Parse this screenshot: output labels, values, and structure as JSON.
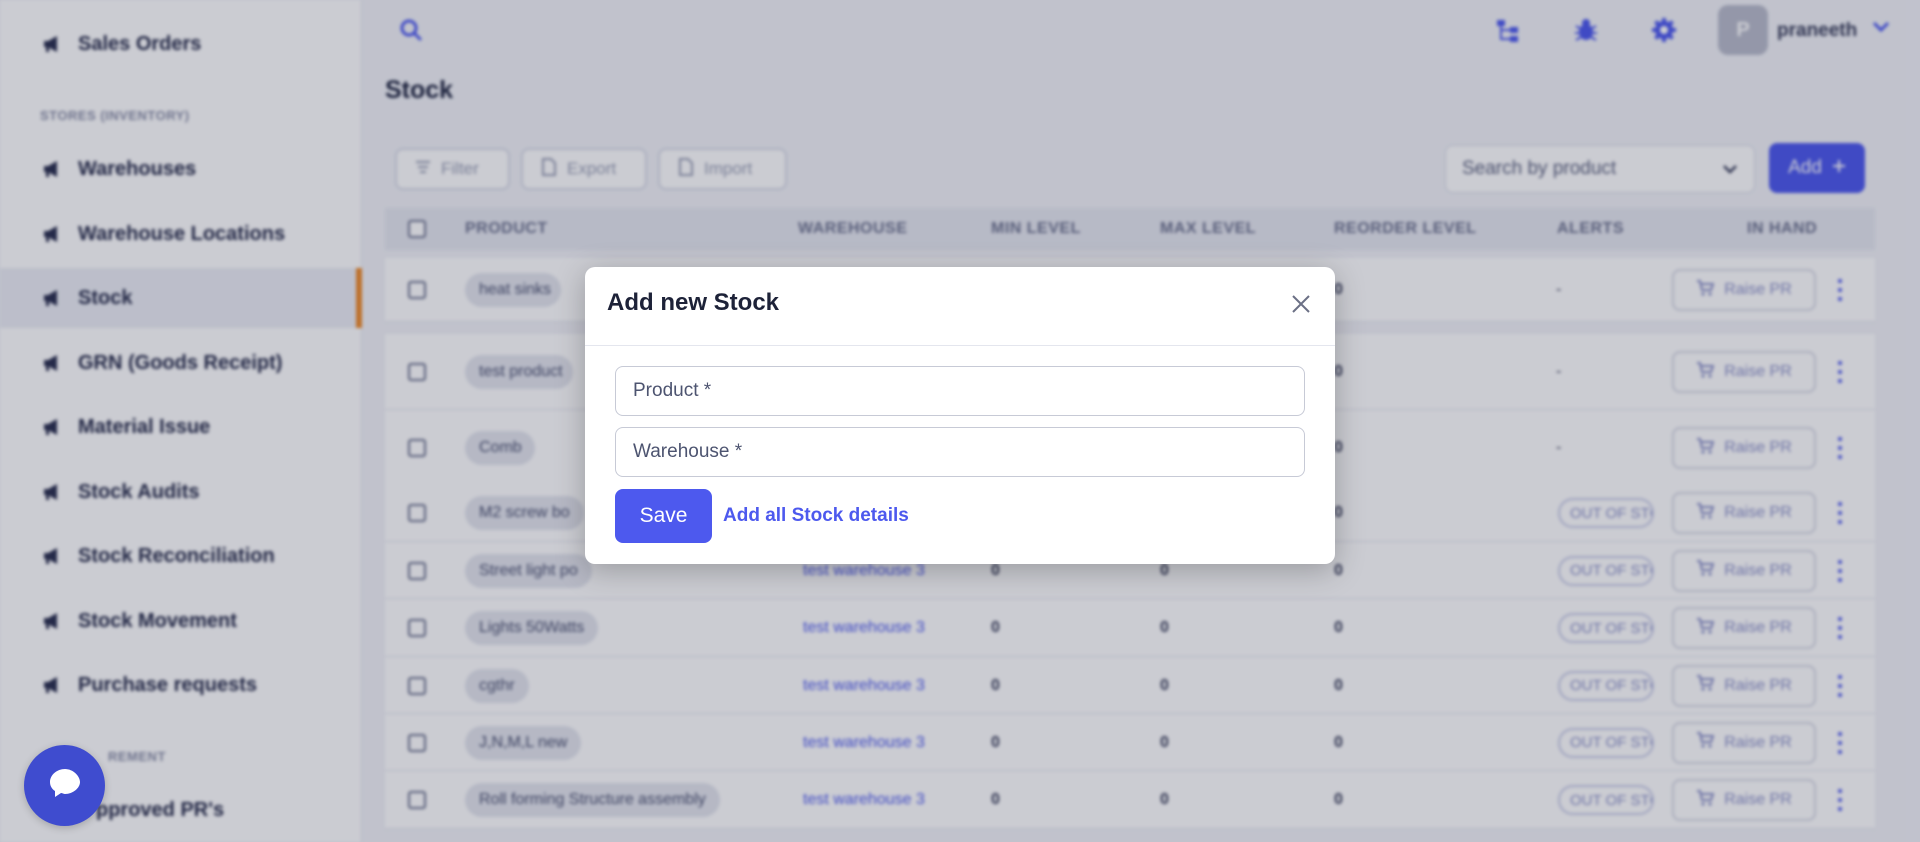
{
  "sidebar": {
    "items": [
      {
        "label": "Sales Orders"
      },
      {
        "label": "Warehouses"
      },
      {
        "label": "Warehouse Locations"
      },
      {
        "label": "Stock"
      },
      {
        "label": "GRN (Goods Receipt)"
      },
      {
        "label": "Material Issue"
      },
      {
        "label": "Stock Audits"
      },
      {
        "label": "Stock Reconciliation"
      },
      {
        "label": "Stock Movement"
      },
      {
        "label": "Purchase requests"
      },
      {
        "label": "pproved PR's"
      }
    ],
    "section_stores": "STORES (INVENTORY)",
    "section_procurement": "REMENT"
  },
  "topbar": {
    "user_initial": "P",
    "username": "praneeth"
  },
  "page": {
    "title": "Stock"
  },
  "toolbar": {
    "filter_label": "Filter",
    "export_label": "Export",
    "import_label": "Import",
    "search_placeholder": "Search by product",
    "add_label": "Add"
  },
  "table": {
    "columns": [
      "PRODUCT",
      "WAREHOUSE",
      "MIN LEVEL",
      "MAX LEVEL",
      "REORDER LEVEL",
      "ALERTS",
      "IN HAND"
    ],
    "raise_label": "Raise PR",
    "rows": [
      {
        "product": "heat sinks",
        "warehouse": "",
        "min": "",
        "max": "",
        "reorder": "0",
        "alert": "-"
      },
      {
        "product": "test product",
        "warehouse": "",
        "min": "",
        "max": "",
        "reorder": "0",
        "alert": "-"
      },
      {
        "product": "Comb",
        "warehouse": "",
        "min": "",
        "max": "",
        "reorder": "0",
        "alert": "-"
      },
      {
        "product": "M2 screw bo",
        "warehouse": "",
        "min": "",
        "max": "",
        "reorder": "0",
        "alert": "OUT OF STOCK"
      },
      {
        "product": "Street light po",
        "warehouse": "test warehouse 3",
        "min": "0",
        "max": "0",
        "reorder": "0",
        "alert": "OUT OF STOCK"
      },
      {
        "product": "Lights 50Watts",
        "warehouse": "test warehouse 3",
        "min": "0",
        "max": "0",
        "reorder": "0",
        "alert": "OUT OF STOCK"
      },
      {
        "product": "cgthr",
        "warehouse": "test warehouse 3",
        "min": "0",
        "max": "0",
        "reorder": "0",
        "alert": "OUT OF STOCK"
      },
      {
        "product": "J,N,M,L new",
        "warehouse": "test warehouse 3",
        "min": "0",
        "max": "0",
        "reorder": "0",
        "alert": "OUT OF STOCK"
      },
      {
        "product": "Roll forming Structure assembly",
        "warehouse": "test warehouse 3",
        "min": "0",
        "max": "0",
        "reorder": "0",
        "alert": "OUT OF STOCK"
      }
    ]
  },
  "modal": {
    "title": "Add new Stock",
    "product_placeholder": "Product *",
    "warehouse_placeholder": "Warehouse *",
    "save_label": "Save",
    "add_all_label": "Add all Stock details"
  },
  "colors": {
    "accent": "#4d59ee",
    "active_marker": "#ee8a2a"
  }
}
